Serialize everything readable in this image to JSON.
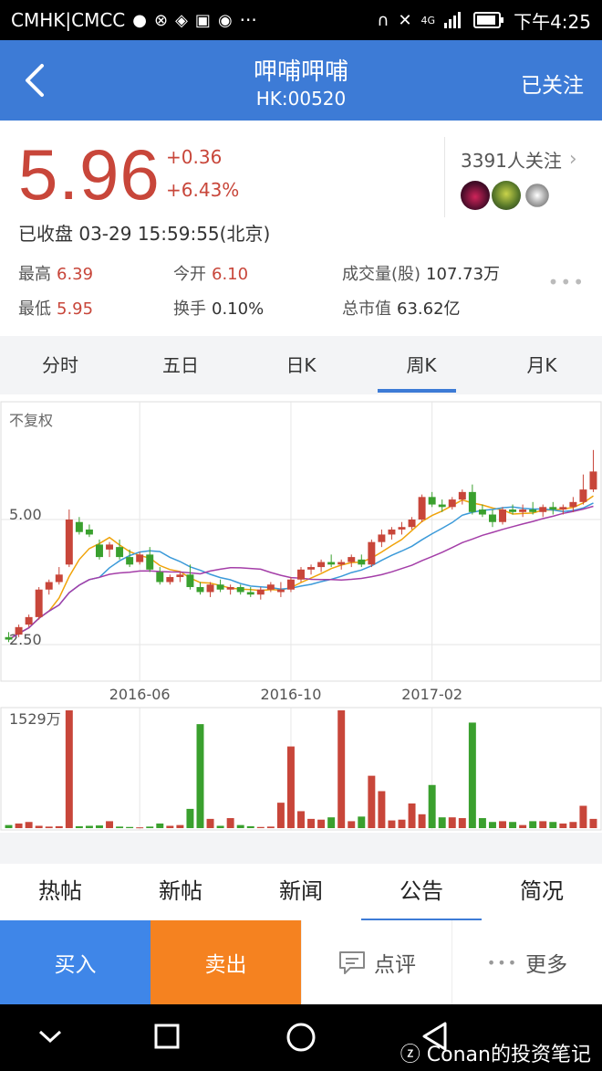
{
  "status_bar": {
    "carrier": "CMHK|CMCC",
    "dots": "···",
    "network": "4G",
    "time": "下午4:25"
  },
  "header": {
    "title": "呷哺呷哺",
    "code": "HK:00520",
    "follow_label": "已关注"
  },
  "quote": {
    "price": "5.96",
    "change": "+0.36",
    "change_pct": "+6.43%",
    "close_time": "已收盘 03-29 15:59:55(北京)",
    "followers": "3391人关注",
    "high_label": "最高",
    "high": "6.39",
    "open_label": "今开",
    "open": "6.10",
    "volume_label": "成交量(股)",
    "volume": "107.73万",
    "low_label": "最低",
    "low": "5.95",
    "turnover_label": "换手",
    "turnover": "0.10%",
    "mktcap_label": "总市值",
    "mktcap": "63.62亿",
    "colors": {
      "up": "#c8463a",
      "down": "#3aa02e"
    }
  },
  "period_tabs": [
    {
      "label": "分时",
      "active": false
    },
    {
      "label": "五日",
      "active": false
    },
    {
      "label": "日K",
      "active": false
    },
    {
      "label": "周K",
      "active": true
    },
    {
      "label": "月K",
      "active": false
    }
  ],
  "chart_data": {
    "type": "candlestick",
    "adjust_label": "不复权",
    "y_ticks": [
      "5.00",
      "2.50"
    ],
    "y_tick_values": [
      5.0,
      2.5
    ],
    "x_ticks": [
      "2016-06",
      "2016-10",
      "2017-02"
    ],
    "x_tick_index": [
      13,
      28,
      42
    ],
    "volume_max_label": "1529万",
    "volume_max": 1529,
    "candles": [
      [
        2.65,
        2.75,
        2.55,
        2.6,
        40
      ],
      [
        2.7,
        2.9,
        2.65,
        2.85,
        60
      ],
      [
        2.9,
        3.1,
        2.85,
        3.05,
        80
      ],
      [
        3.05,
        3.65,
        3.0,
        3.6,
        30
      ],
      [
        3.6,
        3.8,
        3.5,
        3.75,
        20
      ],
      [
        3.75,
        4.05,
        3.7,
        3.9,
        25
      ],
      [
        4.1,
        5.2,
        4.05,
        5.0,
        1529
      ],
      [
        4.95,
        5.05,
        4.7,
        4.75,
        25
      ],
      [
        4.8,
        4.9,
        4.65,
        4.7,
        30
      ],
      [
        4.5,
        4.6,
        4.2,
        4.25,
        35
      ],
      [
        4.4,
        4.55,
        4.25,
        4.5,
        90
      ],
      [
        4.45,
        4.6,
        4.2,
        4.25,
        20
      ],
      [
        4.25,
        4.4,
        4.05,
        4.1,
        15
      ],
      [
        4.15,
        4.35,
        4.1,
        4.3,
        10
      ],
      [
        4.3,
        4.45,
        3.95,
        4.0,
        20
      ],
      [
        3.95,
        4.05,
        3.7,
        3.75,
        60
      ],
      [
        3.75,
        3.9,
        3.7,
        3.85,
        30
      ],
      [
        3.85,
        3.95,
        3.75,
        3.9,
        40
      ],
      [
        3.9,
        4.1,
        3.6,
        3.65,
        250
      ],
      [
        3.65,
        3.75,
        3.5,
        3.55,
        1350
      ],
      [
        3.55,
        3.75,
        3.45,
        3.7,
        120
      ],
      [
        3.7,
        3.8,
        3.55,
        3.6,
        30
      ],
      [
        3.6,
        3.7,
        3.5,
        3.65,
        130
      ],
      [
        3.65,
        3.7,
        3.5,
        3.55,
        40
      ],
      [
        3.55,
        3.65,
        3.45,
        3.5,
        25
      ],
      [
        3.5,
        3.65,
        3.4,
        3.6,
        15
      ],
      [
        3.6,
        3.75,
        3.55,
        3.7,
        20
      ],
      [
        3.55,
        3.75,
        3.45,
        3.6,
        330
      ],
      [
        3.6,
        3.85,
        3.55,
        3.8,
        1060
      ],
      [
        3.8,
        4.05,
        3.75,
        4.0,
        220
      ],
      [
        4.0,
        4.1,
        3.9,
        4.05,
        120
      ],
      [
        4.05,
        4.2,
        3.95,
        4.15,
        110
      ],
      [
        4.15,
        4.3,
        4.05,
        4.1,
        140
      ],
      [
        4.1,
        4.2,
        4.0,
        4.15,
        1529
      ],
      [
        4.15,
        4.3,
        4.05,
        4.25,
        90
      ],
      [
        4.2,
        4.3,
        4.05,
        4.1,
        150
      ],
      [
        4.1,
        4.6,
        4.05,
        4.55,
        680
      ],
      [
        4.55,
        4.8,
        4.45,
        4.7,
        480
      ],
      [
        4.7,
        4.85,
        4.6,
        4.8,
        100
      ],
      [
        4.8,
        4.95,
        4.7,
        4.85,
        110
      ],
      [
        4.85,
        5.05,
        4.8,
        5.0,
        320
      ],
      [
        5.0,
        5.5,
        4.95,
        5.45,
        180
      ],
      [
        5.45,
        5.55,
        5.25,
        5.3,
        560
      ],
      [
        5.3,
        5.4,
        5.15,
        5.25,
        140
      ],
      [
        5.25,
        5.45,
        5.2,
        5.4,
        140
      ],
      [
        5.4,
        5.6,
        5.3,
        5.55,
        130
      ],
      [
        5.55,
        5.7,
        5.1,
        5.15,
        1370
      ],
      [
        5.2,
        5.3,
        5.05,
        5.1,
        130
      ],
      [
        5.1,
        5.2,
        4.85,
        4.95,
        80
      ],
      [
        4.95,
        5.25,
        4.9,
        5.2,
        90
      ],
      [
        5.2,
        5.3,
        5.1,
        5.15,
        80
      ],
      [
        5.15,
        5.3,
        5.05,
        5.2,
        40
      ],
      [
        5.2,
        5.35,
        5.1,
        5.15,
        90
      ],
      [
        5.15,
        5.3,
        5.05,
        5.25,
        90
      ],
      [
        5.25,
        5.35,
        5.1,
        5.2,
        80
      ],
      [
        5.2,
        5.3,
        5.1,
        5.25,
        60
      ],
      [
        5.25,
        5.45,
        5.15,
        5.35,
        80
      ],
      [
        5.35,
        5.9,
        5.3,
        5.6,
        290
      ],
      [
        5.6,
        6.39,
        5.55,
        5.96,
        120
      ]
    ],
    "ma_colors": [
      "#f0a30a",
      "#3b9ad9",
      "#a43ea8"
    ]
  },
  "news_tabs": [
    {
      "label": "热帖",
      "active": false
    },
    {
      "label": "新帖",
      "active": false
    },
    {
      "label": "新闻",
      "active": false
    },
    {
      "label": "公告",
      "active": true
    },
    {
      "label": "简况",
      "active": false
    }
  ],
  "actions": {
    "buy": "买入",
    "sell": "卖出",
    "comment": "点评",
    "more": "更多"
  },
  "watermark": "Conan的投资笔记"
}
